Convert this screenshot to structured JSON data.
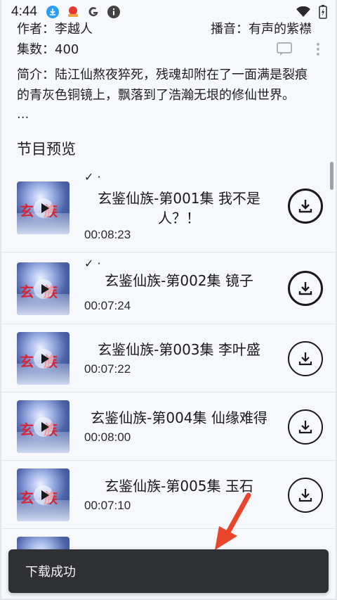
{
  "status_bar": {
    "time": "4:44",
    "left_icons": [
      "download-notification-icon",
      "app-notification-icon",
      "google-icon",
      "info-icon"
    ],
    "right_icons": [
      "wifi-icon",
      "battery-icon"
    ]
  },
  "detail": {
    "author_line": "作者：李越人",
    "narrator_line": "播音：有声的紫襟",
    "episodes_line": "集数：400",
    "intro_line1": "简介：陆江仙熬夜猝死，残魂却附在了一面满是裂痕",
    "intro_line2": "的青灰色铜镜上，飘落到了浩瀚无垠的修仙世界。",
    "intro_more": "...",
    "section_title": "节目预览"
  },
  "episodes": [
    {
      "title": "玄鉴仙族-第001集 我不是人？！",
      "duration": "00:08:23",
      "downloaded": true,
      "check": "✓ ·"
    },
    {
      "title": "玄鉴仙族-第002集 镜子",
      "duration": "00:07:24",
      "downloaded": true,
      "check": "✓ ·"
    },
    {
      "title": "玄鉴仙族-第003集 李叶盛",
      "duration": "00:07:22",
      "downloaded": false,
      "check": ""
    },
    {
      "title": "玄鉴仙族-第004集 仙缘难得",
      "duration": "00:08:00",
      "downloaded": false,
      "check": ""
    },
    {
      "title": "玄鉴仙族-第005集 玉石",
      "duration": "00:07:10",
      "downloaded": false,
      "check": ""
    }
  ],
  "toast": {
    "message": "下载成功"
  },
  "colors": {
    "background": "#f6f8fc",
    "toast_bg": "#2f3033",
    "arrow": "#e8452c"
  }
}
